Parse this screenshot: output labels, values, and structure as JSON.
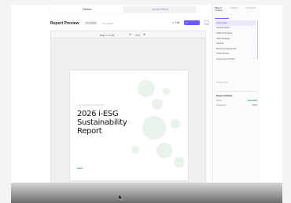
{
  "mode_tabs": [
    "Preview",
    "Source Report"
  ],
  "header": {
    "title": "Report Preview",
    "status": "Generated",
    "pages": "131 pages",
    "edit_label": "Edit",
    "generate_label": "Regenerate"
  },
  "viewer": {
    "page_indicator": "Page 1 of 131",
    "zoom": "75%"
  },
  "cover": {
    "kicker": "SUSTAINABILITY REPORT",
    "title": "2026 i-ESG Sustainability Report",
    "accent_color": "#39b36a"
  },
  "side_panel": {
    "tabs": [
      "Table of Contents",
      "Sections",
      "Comments"
    ],
    "toc": [
      {
        "label": "Cover Page",
        "active": true
      },
      {
        "label": "General Notice",
        "active": false
      },
      {
        "label": "Table of Contents",
        "active": false
      },
      {
        "label": "CEO Message",
        "active": false
      },
      {
        "label": "General",
        "active": false
      },
      {
        "label": "Environmental Section",
        "active": false
      },
      {
        "label": "Social Section",
        "active": false
      },
      {
        "label": "Governance Section",
        "active": false
      }
    ],
    "toc_footer": "25 pages total",
    "details": {
      "title": "Report Details",
      "rows": [
        {
          "label": "Status",
          "value": "Generated",
          "color": "#2e9d59"
        },
        {
          "label": "Completion",
          "value": "100%",
          "color": "#333333"
        }
      ]
    }
  },
  "colors": {
    "accent": "#6b5cff",
    "active_bg": "#ebe8ff"
  }
}
